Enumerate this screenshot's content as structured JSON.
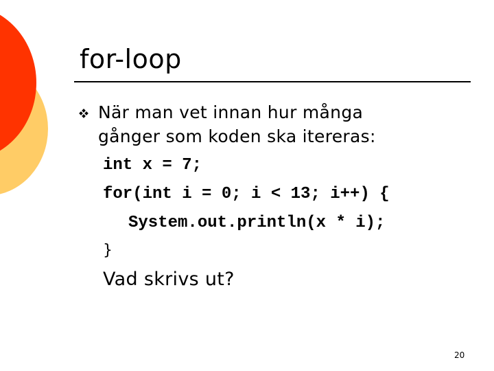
{
  "slide": {
    "title": "for-loop",
    "bullet_icon": "four-diamond-bullet-icon",
    "bullet_text_line1": "När man vet innan hur många",
    "bullet_text_line2": "gånger som koden ska itereras:",
    "code_lines": [
      "int x = 7;",
      "for(int i = 0; i < 13; i++) {",
      "System.out.println(x * i);"
    ],
    "closing_brace": "}",
    "question": "Vad skrivs ut?",
    "page_number": "20"
  },
  "colors": {
    "decor_red": "#ff3300",
    "decor_yellow": "#ffcc66"
  }
}
